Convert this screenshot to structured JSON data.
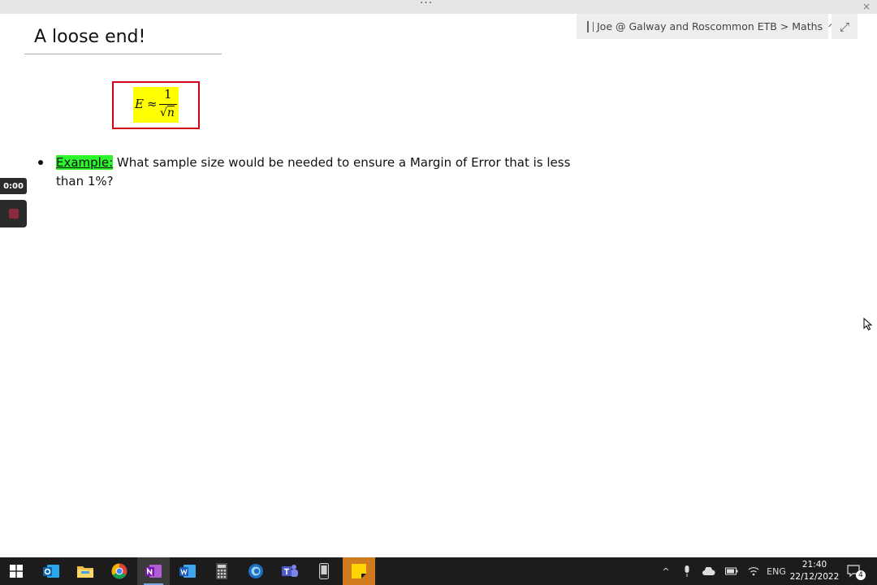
{
  "window": {
    "more_glyph": "···",
    "close_glyph": "×"
  },
  "notebook": {
    "breadcrumb": "Joe @ Galway and Roscommon ETB > Maths",
    "expand_glyph": "⤢"
  },
  "page": {
    "title": "A loose end!",
    "formula": {
      "lhs": "E",
      "relation": "≈",
      "numerator": "1",
      "radical": "√",
      "radicand": "n"
    },
    "example": {
      "label": "Example:",
      "text": " What sample size would be needed to ensure a Margin of Error that is less than 1%?"
    }
  },
  "recorder": {
    "time": "0:00"
  },
  "taskbar": {
    "apps": [
      "start",
      "outlook",
      "file-explorer",
      "chrome",
      "onenote",
      "word",
      "calculator",
      "edge-legacy",
      "teams",
      "phone",
      "sticky-notes"
    ],
    "tray": {
      "chevron": "^",
      "language": "ENG",
      "notification_count": "4"
    },
    "clock": {
      "time": "21:40",
      "date": "22/12/2022"
    }
  },
  "colors": {
    "formula_highlight": "#ffff00",
    "formula_border": "#d40016",
    "example_highlight": "#2ef62e"
  }
}
